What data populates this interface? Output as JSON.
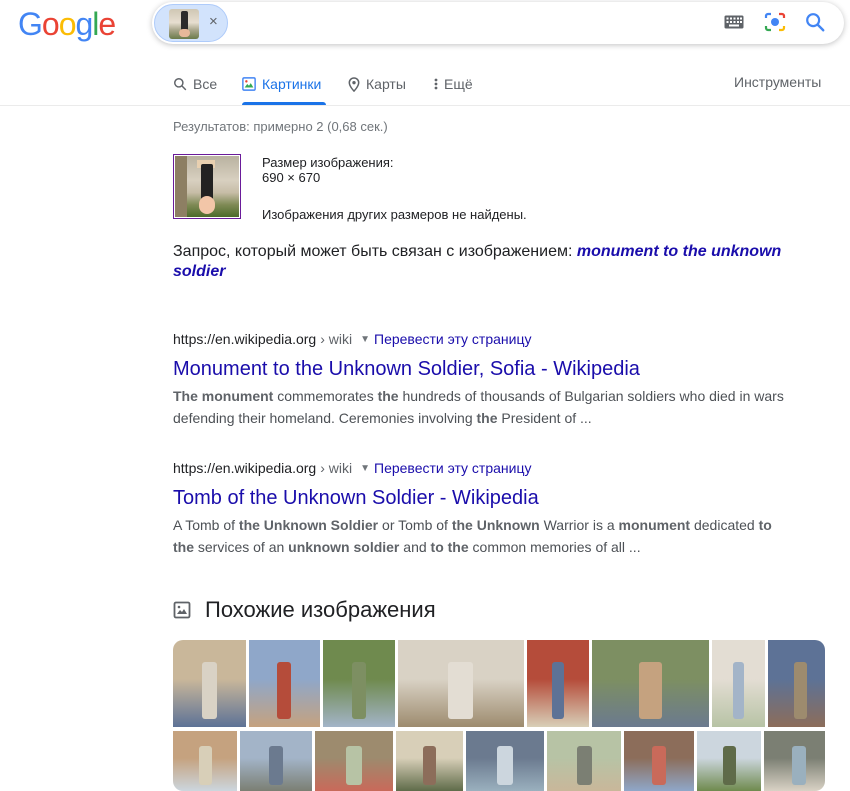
{
  "header": {
    "logo_letters": [
      {
        "ch": "G",
        "color": "#4285F4"
      },
      {
        "ch": "o",
        "color": "#EA4335"
      },
      {
        "ch": "o",
        "color": "#FBBC05"
      },
      {
        "ch": "g",
        "color": "#4285F4"
      },
      {
        "ch": "l",
        "color": "#34A853"
      },
      {
        "ch": "e",
        "color": "#EA4335"
      }
    ],
    "chip_close": "×",
    "icons": [
      "keyboard-icon",
      "camera-lens-icon",
      "search-icon"
    ]
  },
  "tabs": {
    "items": [
      {
        "label": "Все",
        "icon": "search-icon",
        "active": false
      },
      {
        "label": "Картинки",
        "icon": "image-icon",
        "active": true
      },
      {
        "label": "Карты",
        "icon": "map-pin-icon",
        "active": false
      },
      {
        "label": "Ещё",
        "icon": "more-vert-icon",
        "active": false
      }
    ],
    "tools": "Инструменты"
  },
  "results": {
    "stats": "Результатов: примерно 2 (0,68 сек.)",
    "image_size_label": "Размер изображения:",
    "image_size_value": "690 × 670",
    "no_other_sizes": "Изображения других размеров не найдены.",
    "related_prefix": "Запрос, который может быть связан с изображением: ",
    "related_query": "monument to the unknown soldier",
    "items": [
      {
        "url": "https://en.wikipedia.org",
        "path": "› wiki",
        "translate": "Перевести эту страницу",
        "title": "Monument to the Unknown Soldier, Sofia - Wikipedia",
        "snippet_html": "<b>The monument</b> commemorates <b>the</b> hundreds of thousands of Bulgarian soldiers who died in wars defending their homeland. Ceremonies involving <b>the</b> President of ..."
      },
      {
        "url": "https://en.wikipedia.org",
        "path": "› wiki",
        "translate": "Перевести эту страницу",
        "title": "Tomb of the Unknown Soldier - Wikipedia",
        "snippet_html": "A Tomb of <b>the Unknown Soldier</b> or Tomb of <b>the Unknown</b> Warrior is a <b>monument</b> dedicated <b>to the</b> services of an <b>unknown soldier</b> and <b>to the</b> common memories of all ..."
      }
    ]
  },
  "similar": {
    "heading": "Похожие изображения",
    "icon": "image-icon",
    "palette": [
      "#c9b79a",
      "#8fa7c9",
      "#6f8a4e",
      "#d9d2c5",
      "#b54c3a",
      "#7d8f62",
      "#e3ddd3",
      "#5d7296",
      "#c5a27f",
      "#a3b4c8",
      "#9d8b6e",
      "#d8cfb8",
      "#6b7a8f",
      "#b7c3a5",
      "#8c6d5a",
      "#ccd6de",
      "#7b7f73",
      "#c96a5a",
      "#5f6b49",
      "#9ab0be"
    ]
  }
}
